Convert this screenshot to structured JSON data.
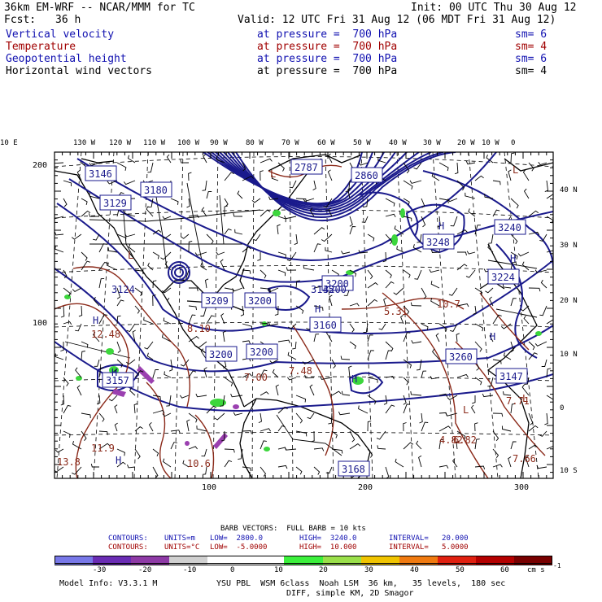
{
  "header": {
    "model": "36km EM-WRF -- NCAR/MMM for TC",
    "init": "Init: 00 UTC Thu 30 Aug 12",
    "fcst_label": "Fcst:",
    "fcst_value": "36 h",
    "valid": "Valid: 12 UTC Fri 31 Aug 12 (06 MDT Fri 31 Aug 12)"
  },
  "fields": [
    {
      "name": "Vertical velocity",
      "level": "at pressure =  700 hPa",
      "smooth": "sm= 6",
      "color": "#1010b0"
    },
    {
      "name": "Temperature",
      "level": "at pressure =  700 hPa",
      "smooth": "sm= 4",
      "color": "#a00000"
    },
    {
      "name": "Geopotential height",
      "level": "at pressure =  700 hPa",
      "smooth": "sm= 6",
      "color": "#1010b0"
    },
    {
      "name": "Horizontal wind vectors",
      "level": "at pressure =  700 hPa",
      "smooth": "sm= 4",
      "color": "#000000"
    }
  ],
  "map": {
    "lon_labels": [
      "130 W",
      "120 W",
      "110 W",
      "100 W",
      "90 W",
      "80 W",
      "70 W",
      "60 W",
      "50 W",
      "40 W",
      "30 W",
      "20 W",
      "10 W",
      "0",
      "10 E"
    ],
    "lat_labels": [
      "40 N",
      "30 N",
      "20 N",
      "10 N",
      "0",
      "10 S"
    ],
    "grid_left_labels": [
      "200",
      "100"
    ],
    "grid_bottom_labels": [
      "100",
      "200",
      "300"
    ],
    "height_labels": [
      "3180",
      "3200",
      "3200",
      "3200",
      "3209",
      "3200",
      "3248",
      "3260",
      "3260",
      "3240",
      "3200",
      "3224",
      "3147",
      "2787",
      "2860",
      "3146",
      "3160",
      "3168",
      "3129",
      "3157",
      "3145",
      "3124"
    ],
    "temp_labels": [
      "12.48",
      "7.48",
      "5.31",
      "10.7",
      "4.82",
      "6.82",
      "7.66",
      "7.71",
      "8.10",
      "11.9",
      "13.8",
      "10.6",
      "7.00"
    ],
    "pressure_centers": [
      "H",
      "H",
      "H",
      "H",
      "H",
      "H",
      "H",
      "H",
      "L",
      "L",
      "L",
      "L",
      "L"
    ],
    "colors": {
      "height_contour": "#1a1a8c",
      "temp_contour": "#8b2a1a",
      "coast": "#000000",
      "grid": "#000000",
      "up_motion": "#3cd63c",
      "down_motion": "#9b40b0"
    }
  },
  "footer": {
    "barb": "BARB VECTORS:  FULL BARB = 10 kts",
    "contours_label": "CONTOURS:",
    "contours1": {
      "units": "UNITS=m",
      "low": "LOW=  2800.0",
      "high": "HIGH=  3240.0",
      "interval": "INTERVAL=   20.000"
    },
    "contours2": {
      "units": "UNITS=°C",
      "low": "LOW=  -5.0000",
      "high": "HIGH=  10.000",
      "interval": "INTERVAL=   5.0000"
    },
    "colorbar_ticks": [
      "-30",
      "-20",
      "-10",
      "0",
      "10",
      "20",
      "30",
      "40",
      "50",
      "60"
    ],
    "colorbar_unit": "cm s",
    "colorbar_unit_exp": "-1",
    "colorbar_colors": [
      "#7878e8",
      "#6a2cb4",
      "#8e3aa6",
      "#d0d0d0",
      "#ffffff",
      "#ffffff",
      "#3cf03c",
      "#9ae04a",
      "#f0c400",
      "#f07a10",
      "#e02010",
      "#b40000",
      "#780000"
    ],
    "model_info": "Model Info: V3.3.1 M",
    "physics": "YSU PBL  WSM 6class  Noah LSM  36 km,   35 levels,  180 sec",
    "diff": "DIFF, simple KM, 2D Smagor"
  }
}
